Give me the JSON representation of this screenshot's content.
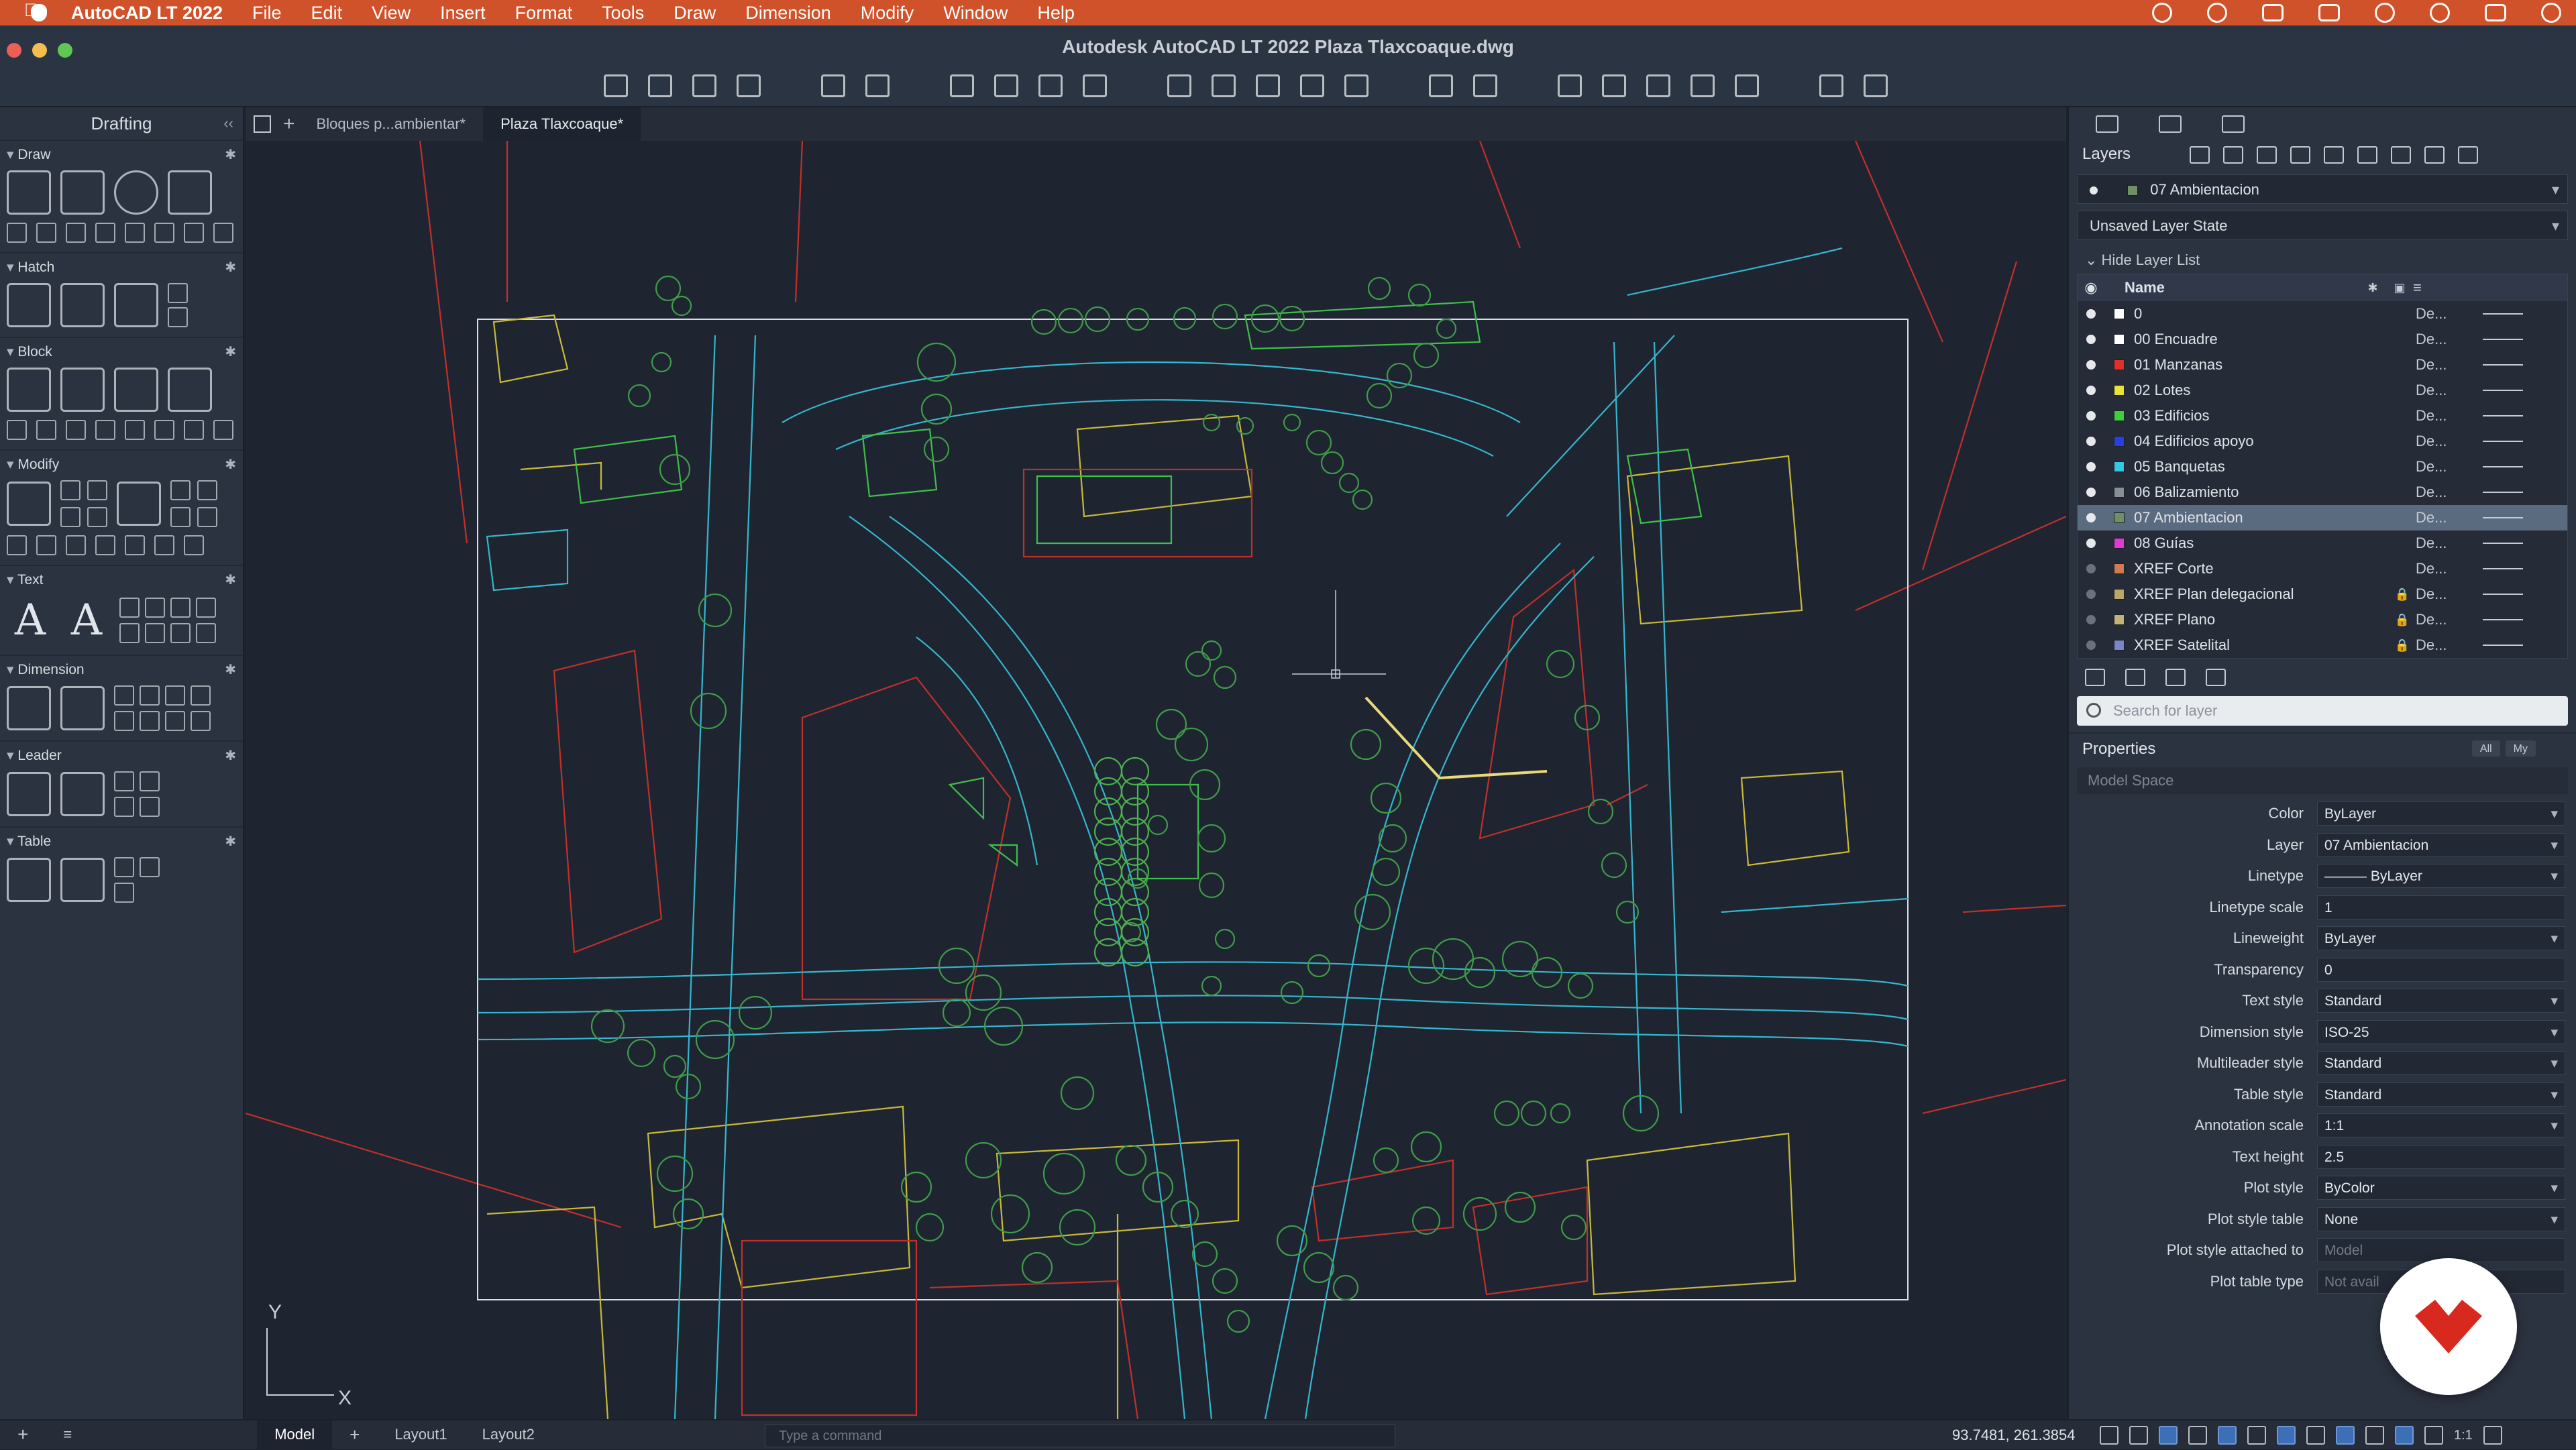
{
  "menubar": {
    "app_name": "AutoCAD LT 2022",
    "items": [
      "File",
      "Edit",
      "View",
      "Insert",
      "Format",
      "Tools",
      "Draw",
      "Dimension",
      "Modify",
      "Window",
      "Help"
    ],
    "right_icons": [
      "creative-cloud-icon",
      "sync-icon",
      "cmd-icon",
      "volume-icon",
      "wifi-icon",
      "spotlight-search-icon",
      "control-center-icon",
      "siri-icon"
    ]
  },
  "window": {
    "title": "Autodesk AutoCAD LT 2022   Plaza Tlaxcoaque.dwg"
  },
  "palette": {
    "title": "Drafting",
    "sections": [
      "Draw",
      "Hatch",
      "Block",
      "Modify",
      "Text",
      "Dimension",
      "Leader",
      "Table"
    ]
  },
  "tabs": {
    "items": [
      "Bloques p...ambientar*",
      "Plaza Tlaxcoaque*"
    ],
    "active": "Plaza Tlaxcoaque*"
  },
  "canvas": {
    "ucs_x": "X",
    "ucs_y": "Y"
  },
  "layers": {
    "title": "Layers",
    "current_layer": "07 Ambientacion",
    "layer_state": "Unsaved Layer State",
    "hide_list_label": "Hide Layer List",
    "col_name": "Name",
    "rows": [
      {
        "name": "0",
        "color": "#ffffff",
        "linetype": "De...",
        "locked": false,
        "on": true
      },
      {
        "name": "00 Encuadre",
        "color": "#ffffff",
        "linetype": "De...",
        "locked": false,
        "on": true
      },
      {
        "name": "01 Manzanas",
        "color": "#e0302a",
        "linetype": "De...",
        "locked": false,
        "on": true
      },
      {
        "name": "02 Lotes",
        "color": "#e8e23a",
        "linetype": "De...",
        "locked": false,
        "on": true
      },
      {
        "name": "03 Edificios",
        "color": "#3fcf3a",
        "linetype": "De...",
        "locked": false,
        "on": true
      },
      {
        "name": "04 Edificios apoyo",
        "color": "#2a3fe0",
        "linetype": "De...",
        "locked": false,
        "on": true
      },
      {
        "name": "05 Banquetas",
        "color": "#36c8e0",
        "linetype": "De...",
        "locked": false,
        "on": true
      },
      {
        "name": "06 Balizamiento",
        "color": "#8a8f97",
        "linetype": "De...",
        "locked": false,
        "on": true
      },
      {
        "name": "07 Ambientacion",
        "color": "#6f8f64",
        "linetype": "De...",
        "locked": false,
        "on": true
      },
      {
        "name": "08 Guías",
        "color": "#e03ad2",
        "linetype": "De...",
        "locked": false,
        "on": true
      },
      {
        "name": "XREF Corte",
        "color": "#d07a50",
        "linetype": "De...",
        "locked": false,
        "on": false
      },
      {
        "name": "XREF Plan delegacional",
        "color": "#b9a76a",
        "linetype": "De...",
        "locked": true,
        "on": false
      },
      {
        "name": "XREF Plano",
        "color": "#c3b27a",
        "linetype": "De...",
        "locked": true,
        "on": false
      },
      {
        "name": "XREF Satelital",
        "color": "#7b86c8",
        "linetype": "De...",
        "locked": true,
        "on": false
      }
    ],
    "search_placeholder": "Search for layer"
  },
  "properties": {
    "title": "Properties",
    "filter_all": "All",
    "filter_my": "My",
    "space": "Model Space",
    "rows": [
      {
        "label": "Color",
        "value": "ByLayer",
        "dropdown": true
      },
      {
        "label": "Layer",
        "value": "07 Ambientacion",
        "dropdown": true
      },
      {
        "label": "Linetype",
        "value": "——— ByLayer",
        "dropdown": true
      },
      {
        "label": "Linetype scale",
        "value": "1",
        "dropdown": false
      },
      {
        "label": "Lineweight",
        "value": "ByLayer",
        "dropdown": true
      },
      {
        "label": "Transparency",
        "value": "0",
        "dropdown": false
      },
      {
        "label": "Text style",
        "value": "Standard",
        "dropdown": true
      },
      {
        "label": "Dimension style",
        "value": "ISO-25",
        "dropdown": true
      },
      {
        "label": "Multileader style",
        "value": "Standard",
        "dropdown": true
      },
      {
        "label": "Table style",
        "value": "Standard",
        "dropdown": true
      },
      {
        "label": "Annotation scale",
        "value": "1:1",
        "dropdown": true
      },
      {
        "label": "Text height",
        "value": "2.5",
        "dropdown": false
      },
      {
        "label": "Plot style",
        "value": "ByColor",
        "dropdown": true
      },
      {
        "label": "Plot style table",
        "value": "None",
        "dropdown": true
      },
      {
        "label": "Plot style attached to",
        "value": "Model",
        "dropdown": false,
        "dim": true
      },
      {
        "label": "Plot table type",
        "value": "Not avail",
        "dropdown": false,
        "dim": true
      }
    ]
  },
  "statusbar": {
    "tabs": [
      "Model",
      "Layout1",
      "Layout2"
    ],
    "active": "Model",
    "command_placeholder": "Type a command",
    "coords": "93.7481, 261.3854",
    "scale": "1:1"
  },
  "colors": {
    "menubar": "#d0522a",
    "accent": "#3d6fb6"
  }
}
